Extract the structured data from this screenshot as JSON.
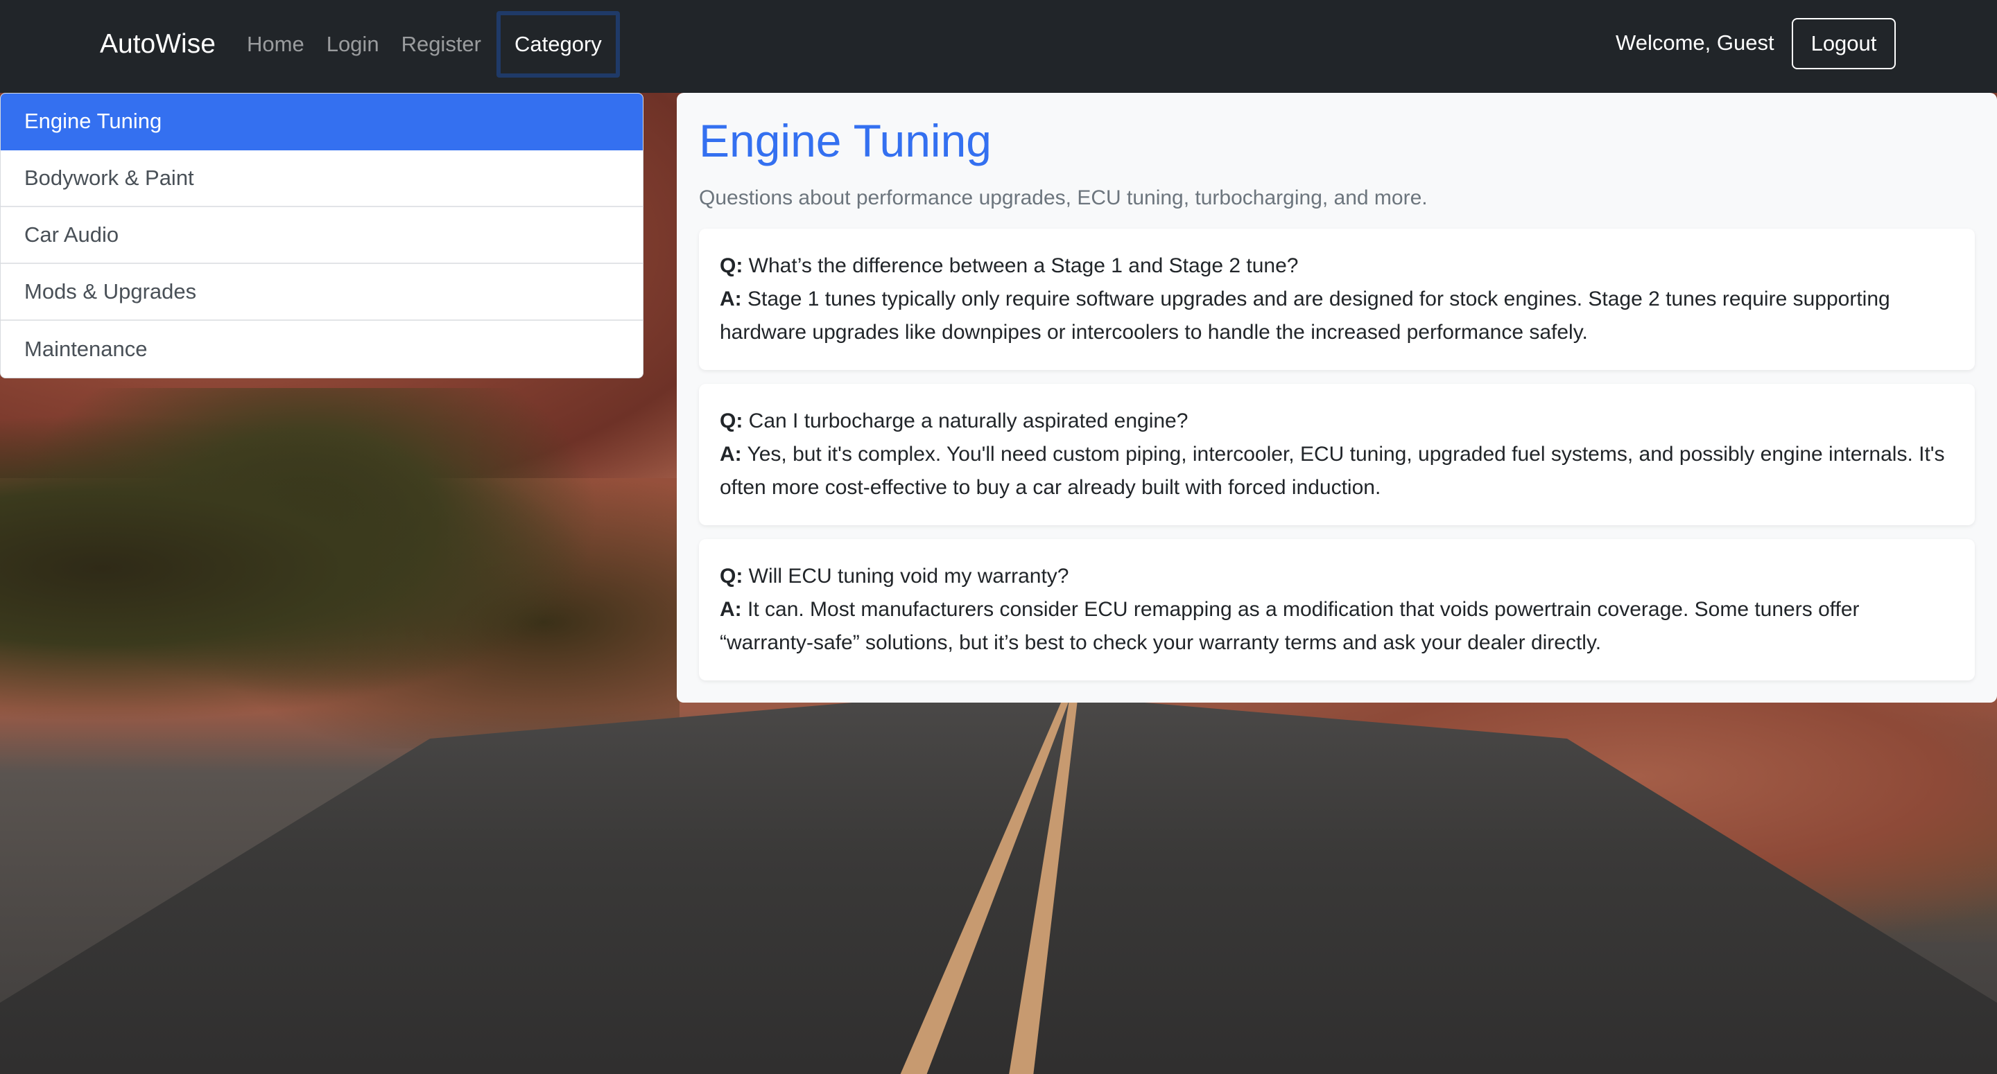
{
  "navbar": {
    "brand": "AutoWise",
    "links": [
      {
        "label": "Home"
      },
      {
        "label": "Login"
      },
      {
        "label": "Register"
      },
      {
        "label": "Category"
      }
    ],
    "welcome": "Welcome, Guest",
    "logout_label": "Logout"
  },
  "sidebar": {
    "items": [
      {
        "label": "Engine Tuning",
        "active": true
      },
      {
        "label": "Bodywork & Paint"
      },
      {
        "label": "Car Audio"
      },
      {
        "label": "Mods & Upgrades"
      },
      {
        "label": "Maintenance"
      }
    ]
  },
  "main": {
    "title": "Engine Tuning",
    "subtitle": "Questions about performance upgrades, ECU tuning, turbocharging, and more.",
    "q_prefix": "Q:",
    "a_prefix": "A:",
    "faqs": [
      {
        "question": "What’s the difference between a Stage 1 and Stage 2 tune?",
        "answer": "Stage 1 tunes typically only require software upgrades and are designed for stock engines. Stage 2 tunes require supporting hardware upgrades like downpipes or intercoolers to handle the increased performance safely."
      },
      {
        "question": "Can I turbocharge a naturally aspirated engine?",
        "answer": "Yes, but it's complex. You'll need custom piping, intercooler, ECU tuning, upgraded fuel systems, and possibly engine internals. It's often more cost-effective to buy a car already built with forced induction."
      },
      {
        "question": "Will ECU tuning void my warranty?",
        "answer": "It can. Most manufacturers consider ECU remapping as a modification that voids powertrain coverage. Some tuners offer “warranty-safe” solutions, but it’s best to check your warranty terms and ask your dealer directly."
      }
    ]
  },
  "colors": {
    "navbar_bg": "#212529",
    "accent": "#3470f0",
    "card_bg": "#f8f9fa"
  }
}
